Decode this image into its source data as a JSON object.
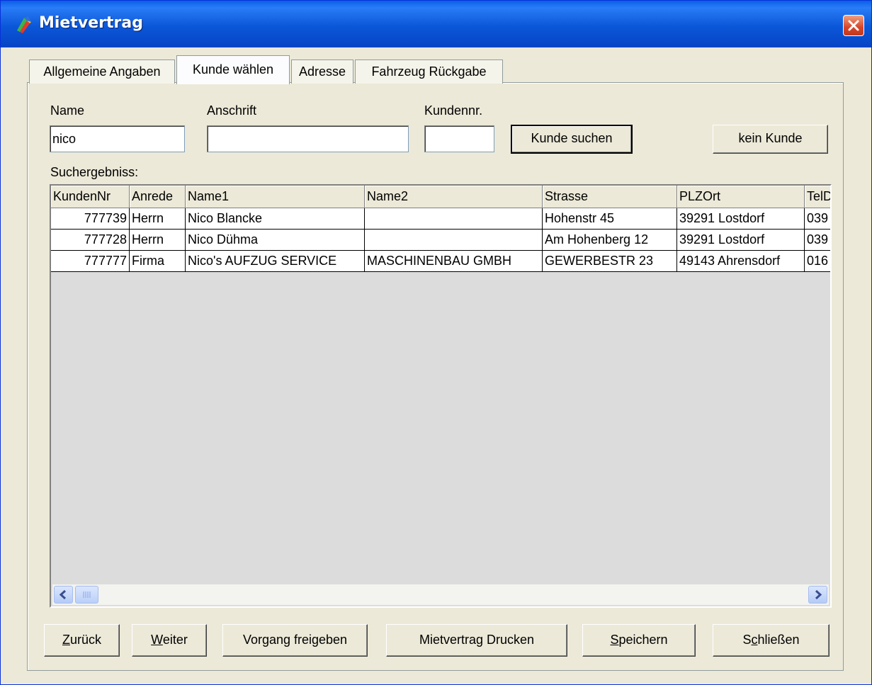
{
  "window": {
    "title": "Mietvertrag"
  },
  "tabs": [
    {
      "label": "Allgemeine Angaben",
      "active": false
    },
    {
      "label": "Kunde wählen",
      "active": true
    },
    {
      "label": "Adresse",
      "active": false
    },
    {
      "label": "Fahrzeug Rückgabe",
      "active": false
    }
  ],
  "search": {
    "name_label": "Name",
    "name_value": "nico",
    "anschrift_label": "Anschrift",
    "anschrift_value": "",
    "kundennr_label": "Kundennr.",
    "kundennr_value": "",
    "search_button": "Kunde suchen",
    "no_customer_button": "kein Kunde"
  },
  "results": {
    "label": "Suchergebniss:",
    "columns": [
      "KundenNr",
      "Anrede",
      "Name1",
      "Name2",
      "Strasse",
      "PLZOrt",
      "TelD"
    ],
    "rows": [
      [
        "777739",
        "Herrn",
        "Nico Blancke",
        "",
        "Hohenstr 45",
        "39291 Lostdorf",
        "039"
      ],
      [
        "777728",
        "Herrn",
        "Nico Dühma",
        "",
        "Am Hohenberg 12",
        "39291 Lostdorf",
        "039"
      ],
      [
        "777777",
        "Firma",
        "Nico's AUFZUG SERVICE",
        "MASCHINENBAU GMBH",
        "GEWERBESTR 23",
        "49143 Ahrensdorf",
        "016"
      ]
    ]
  },
  "footer": {
    "back": {
      "pre": "",
      "accel": "Z",
      "post": "urück"
    },
    "next": {
      "pre": "",
      "accel": "W",
      "post": "eiter"
    },
    "release": "Vorgang freigeben",
    "print": "Mietvertrag Drucken",
    "save": {
      "pre": "",
      "accel": "S",
      "post": "peichern"
    },
    "close": {
      "pre": "S",
      "accel": "c",
      "post": "hließen"
    }
  }
}
